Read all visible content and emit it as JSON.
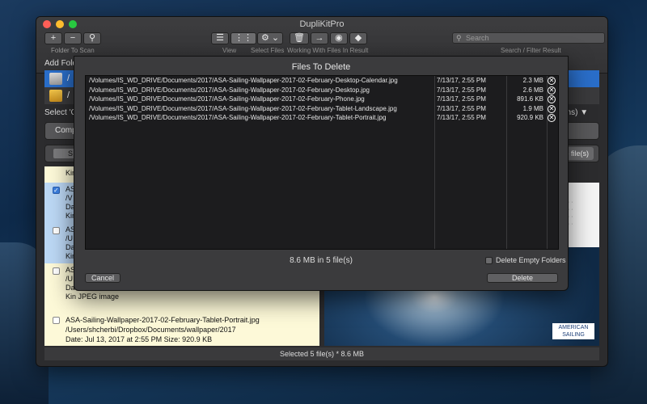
{
  "window": {
    "title": "DupliKitPro"
  },
  "toolbar": {
    "folder_add": "+",
    "folder_remove": "−",
    "folder_label": "Folder To Scan",
    "view_label": "View",
    "select_label": "Select Files",
    "select_icon": "⚙ ⌄",
    "working_label": "Working With Files In Result",
    "search_placeholder": "Search",
    "search_label": "Search / Filter Result"
  },
  "background": {
    "add_folder_label": "Add Folde",
    "folder_row_1": "/",
    "folder_row_2": "/",
    "select_label": "Select 'Co",
    "select_label_right": "ons)",
    "compare_button": "Compa",
    "sel_button": "S",
    "delete_files_button": "te file(s)",
    "results": [
      {
        "name": "Kin",
        "path": "",
        "date": "",
        "kind": "",
        "checked": false
      },
      {
        "name": "ASA",
        "path": "/V",
        "date": "Da",
        "kind": "Kin",
        "checked": true
      },
      {
        "name": "AS",
        "path": "/U",
        "date": "Da",
        "kind": "Kin",
        "checked": false
      },
      {
        "name": "AS",
        "path": "/U",
        "date": "Da",
        "kind": "Kin   JPEG image",
        "checked": false
      }
    ],
    "last_result": {
      "name": "ASA-Sailing-Wallpaper-2017-02-February-Tablet-Portrait.jpg",
      "path": "/Users/shcherbi/Dropbox/Documents/wallpaper/2017",
      "date": "Date:    Jul 13, 2017 at 2:55 PM        Size:   920.9 KB",
      "kind": "Kind:   JPEG image"
    },
    "status": "Selected 5 file(s)  *  8.6 MB",
    "preview_logo": "AMERICAN SAILING"
  },
  "sheet": {
    "title": "Files To Delete",
    "files": [
      {
        "path": "/Volumes/IS_WD_DRIVE/Documents/2017/ASA-Sailing-Wallpaper-2017-02-February-Desktop-Calendar.jpg",
        "date": "7/13/17, 2:55 PM",
        "size": "2.3 MB"
      },
      {
        "path": "/Volumes/IS_WD_DRIVE/Documents/2017/ASA-Sailing-Wallpaper-2017-02-February-Desktop.jpg",
        "date": "7/13/17, 2:55 PM",
        "size": "2.6 MB"
      },
      {
        "path": "/Volumes/IS_WD_DRIVE/Documents/2017/ASA-Sailing-Wallpaper-2017-02-February-Phone.jpg",
        "date": "7/13/17, 2:55 PM",
        "size": "891.6 KB"
      },
      {
        "path": "/Volumes/IS_WD_DRIVE/Documents/2017/ASA-Sailing-Wallpaper-2017-02-February-Tablet-Landscape.jpg",
        "date": "7/13/17, 2:55 PM",
        "size": "1.9 MB"
      },
      {
        "path": "/Volumes/IS_WD_DRIVE/Documents/2017/ASA-Sailing-Wallpaper-2017-02-February-Tablet-Portrait.jpg",
        "date": "7/13/17, 2:55 PM",
        "size": "920.9 KB"
      }
    ],
    "remove_glyph": "✕",
    "summary": "8.6 MB in 5 file(s)",
    "delete_empty_folders": "Delete Empty Folders",
    "cancel": "Cancel",
    "delete": "Delete"
  }
}
